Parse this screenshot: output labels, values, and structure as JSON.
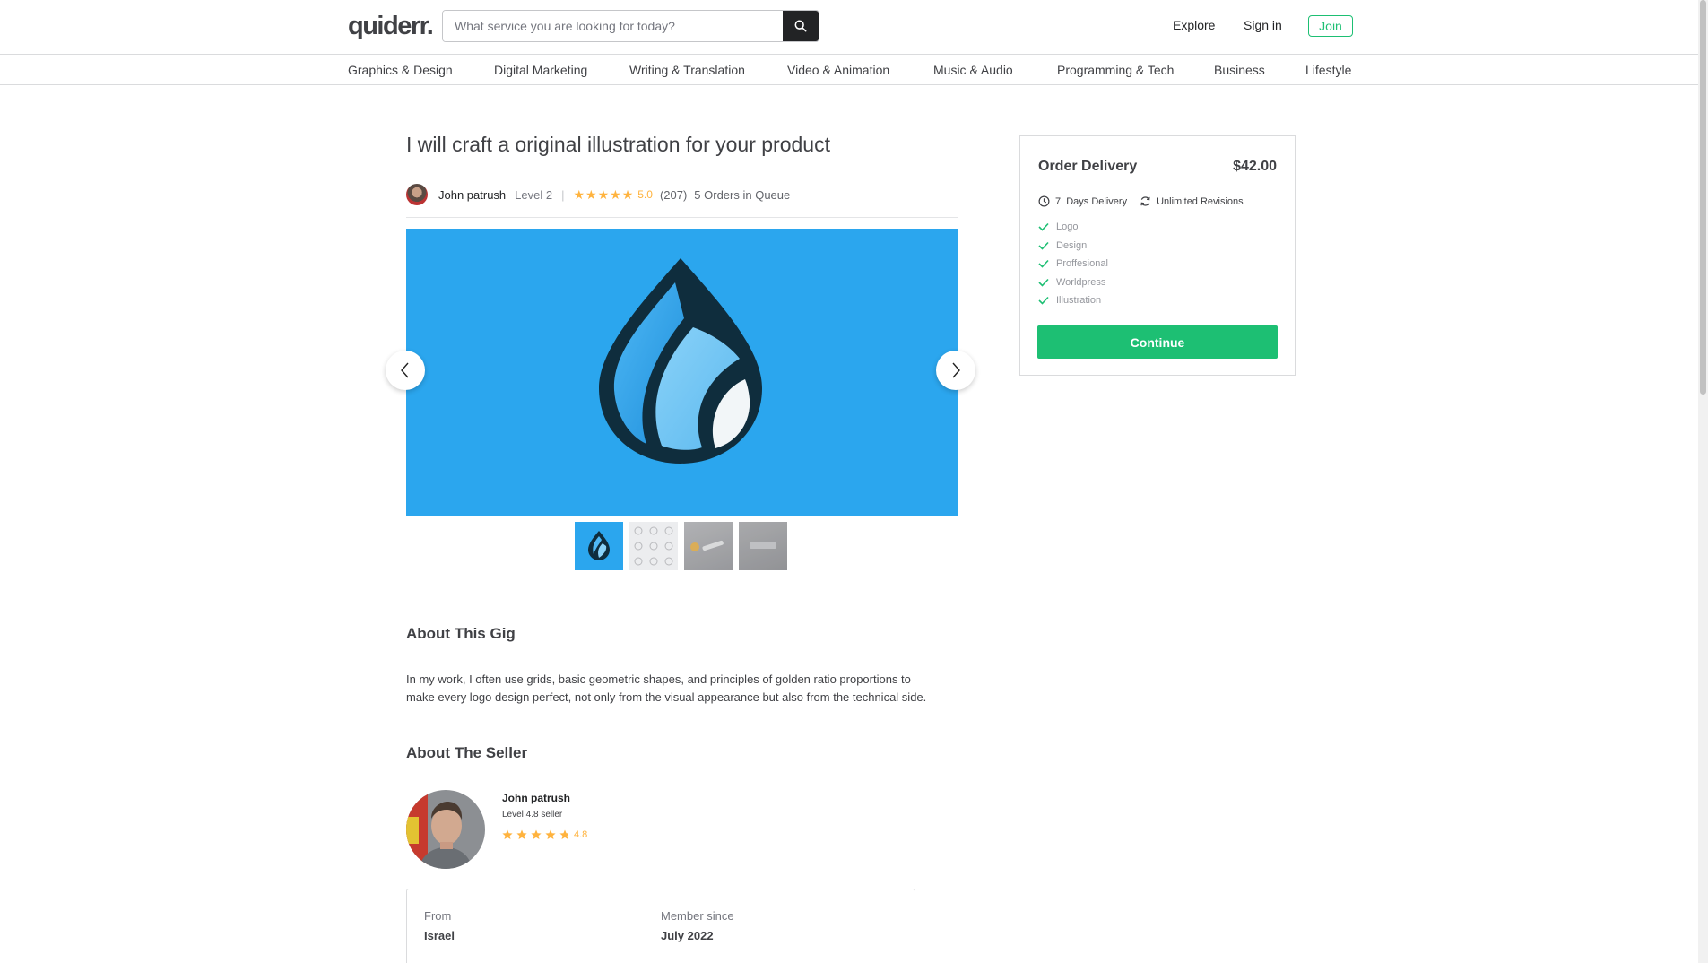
{
  "header": {
    "logo": "quiderr.",
    "search_placeholder": "What service you are looking for today?",
    "explore": "Explore",
    "sign_in": "Sign in",
    "join": "Join"
  },
  "categories": [
    "Graphics & Design",
    "Digital Marketing",
    "Writing & Translation",
    "Video & Animation",
    "Music & Audio",
    "Programming & Tech",
    "Business",
    "Lifestyle"
  ],
  "gig": {
    "title": "I will craft a original illustration for your product",
    "seller_name": "John patrush",
    "seller_level": "Level 2",
    "separator": "|",
    "stars": "★★★★★",
    "rating": "5.0",
    "reviews": "(207)",
    "queue": "5 Orders in Queue"
  },
  "about": {
    "heading": "About This Gig",
    "text": "In my work, I often use grids, basic geometric shapes, and principles of golden ratio proportions to make every logo design perfect, not only from the visual appearance but also from the technical side."
  },
  "seller": {
    "heading": "About The Seller",
    "name": "John patrush",
    "level": "Level 4.8 seller",
    "rating": "4.8",
    "rating_value": 4.8,
    "from_label": "From",
    "from_value": "Israel",
    "member_label": "Member since",
    "member_value": "July 2022"
  },
  "order": {
    "title": "Order Delivery",
    "price": "$42.00",
    "delivery": "7  Days Delivery",
    "revisions": "Unlimited Revisions",
    "features": [
      "Logo",
      "Design",
      "Proffesional",
      "Worldpress",
      "Illustration"
    ],
    "continue": "Continue"
  },
  "colors": {
    "brand_green": "#1dbf73",
    "star": "#ffb33e",
    "hero_bg": "#2ba6ee"
  }
}
